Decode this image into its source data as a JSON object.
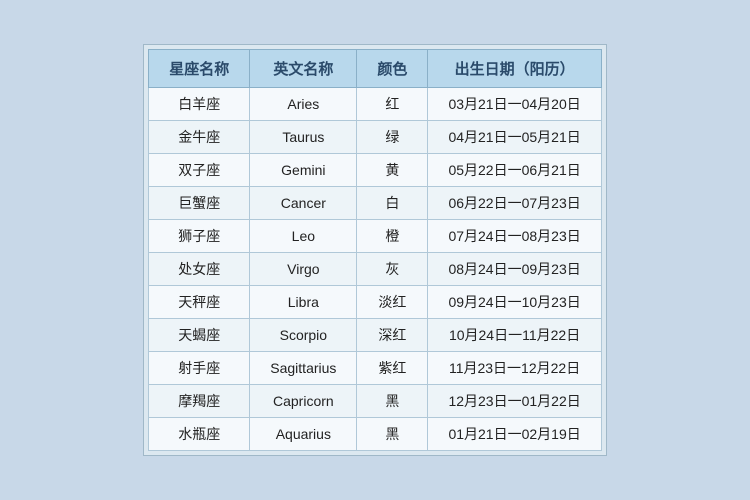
{
  "table": {
    "headers": [
      "星座名称",
      "英文名称",
      "颜色",
      "出生日期（阳历）"
    ],
    "rows": [
      {
        "chinese": "白羊座",
        "english": "Aries",
        "color": "红",
        "dates": "03月21日一04月20日"
      },
      {
        "chinese": "金牛座",
        "english": "Taurus",
        "color": "绿",
        "dates": "04月21日一05月21日"
      },
      {
        "chinese": "双子座",
        "english": "Gemini",
        "color": "黄",
        "dates": "05月22日一06月21日"
      },
      {
        "chinese": "巨蟹座",
        "english": "Cancer",
        "color": "白",
        "dates": "06月22日一07月23日"
      },
      {
        "chinese": "狮子座",
        "english": "Leo",
        "color": "橙",
        "dates": "07月24日一08月23日"
      },
      {
        "chinese": "处女座",
        "english": "Virgo",
        "color": "灰",
        "dates": "08月24日一09月23日"
      },
      {
        "chinese": "天秤座",
        "english": "Libra",
        "color": "淡红",
        "dates": "09月24日一10月23日"
      },
      {
        "chinese": "天蝎座",
        "english": "Scorpio",
        "color": "深红",
        "dates": "10月24日一11月22日"
      },
      {
        "chinese": "射手座",
        "english": "Sagittarius",
        "color": "紫红",
        "dates": "11月23日一12月22日"
      },
      {
        "chinese": "摩羯座",
        "english": "Capricorn",
        "color": "黑",
        "dates": "12月23日一01月22日"
      },
      {
        "chinese": "水瓶座",
        "english": "Aquarius",
        "color": "黑",
        "dates": "01月21日一02月19日"
      }
    ]
  }
}
